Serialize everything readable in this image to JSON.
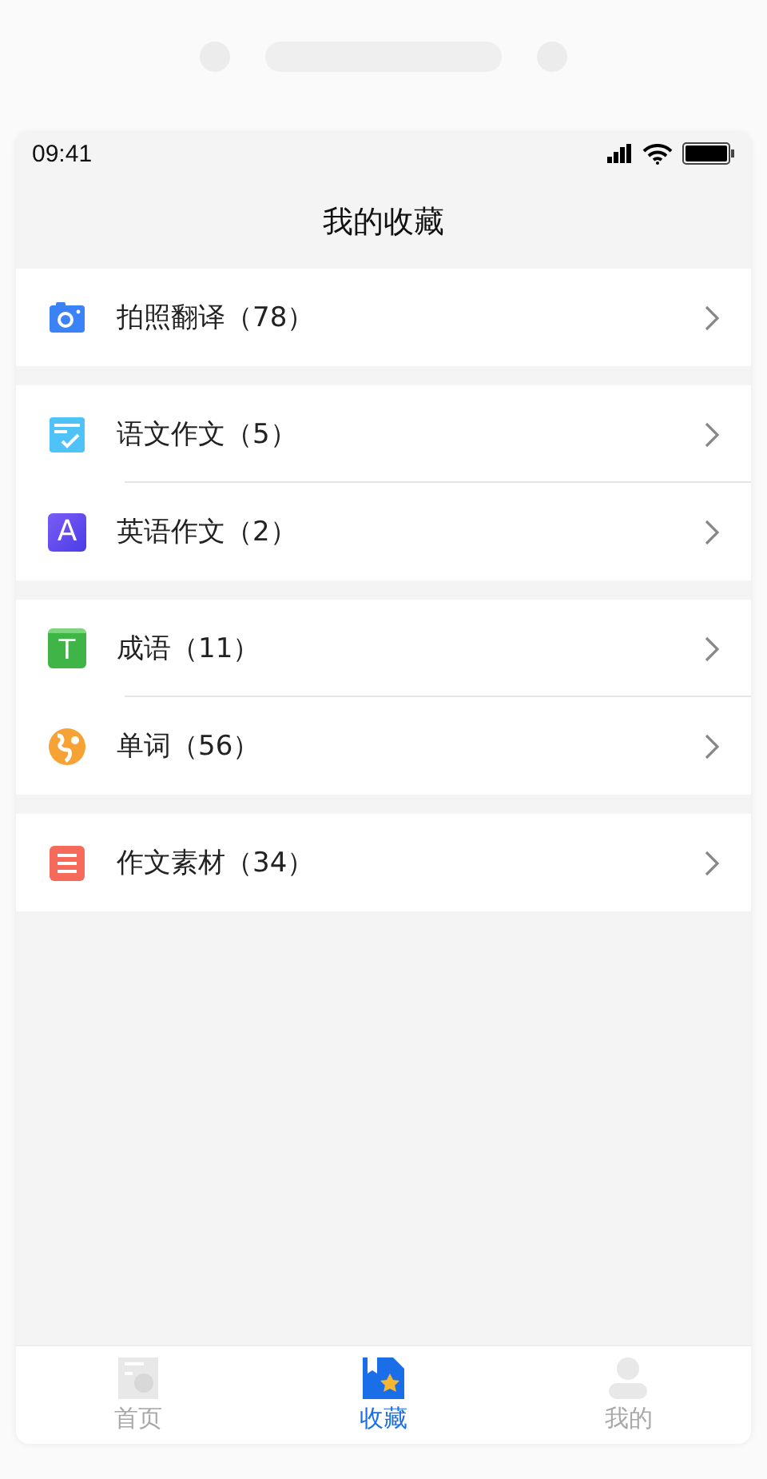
{
  "status_bar": {
    "time": "09:41"
  },
  "title": "我的收藏",
  "groups": [
    {
      "items": [
        {
          "kind": "camera",
          "label": "拍照翻译（78）"
        }
      ]
    },
    {
      "items": [
        {
          "kind": "checklist",
          "label": "语文作文（5）"
        },
        {
          "kind": "letter",
          "icon_letter": "A",
          "label": "英语作文（2）"
        }
      ]
    },
    {
      "items": [
        {
          "kind": "letter-green",
          "icon_letter": "T",
          "label": "成语（11）"
        },
        {
          "kind": "globe",
          "label": "单词（56）"
        }
      ]
    },
    {
      "items": [
        {
          "kind": "lines",
          "label": "作文素材（34）"
        }
      ]
    }
  ],
  "tabs": [
    {
      "kind": "home",
      "label": "首页",
      "selected": false
    },
    {
      "kind": "favorites",
      "label": "收藏",
      "selected": true
    },
    {
      "kind": "profile",
      "label": "我的",
      "selected": false
    }
  ]
}
